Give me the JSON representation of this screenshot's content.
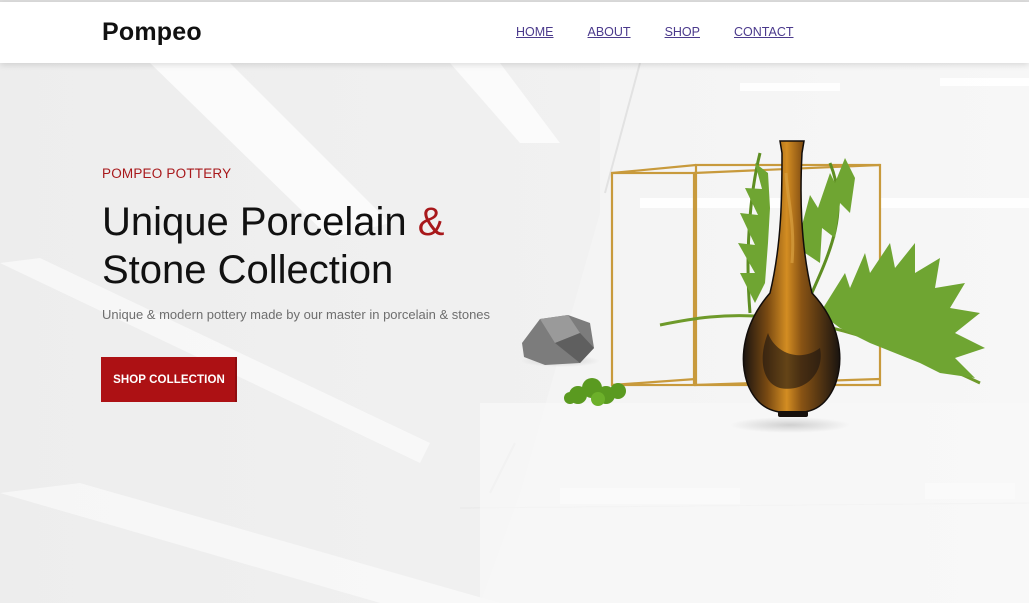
{
  "brand": {
    "logo": "Pompeo"
  },
  "nav": {
    "items": [
      {
        "label": "HOME"
      },
      {
        "label": "ABOUT"
      },
      {
        "label": "SHOP"
      },
      {
        "label": "CONTACT"
      }
    ],
    "link_color": "#4b3a8c"
  },
  "hero": {
    "eyebrow": "POMPEO POTTERY",
    "headline_part1": "Unique Porcelain",
    "headline_amp": "&",
    "headline_part2": "Stone Collection",
    "subtext": "Unique & modern pottery made by our master in porcelain & stones",
    "cta_label": "SHOP COLLECTION",
    "accent_color": "#a8181b",
    "cta_color": "#ad1114"
  }
}
